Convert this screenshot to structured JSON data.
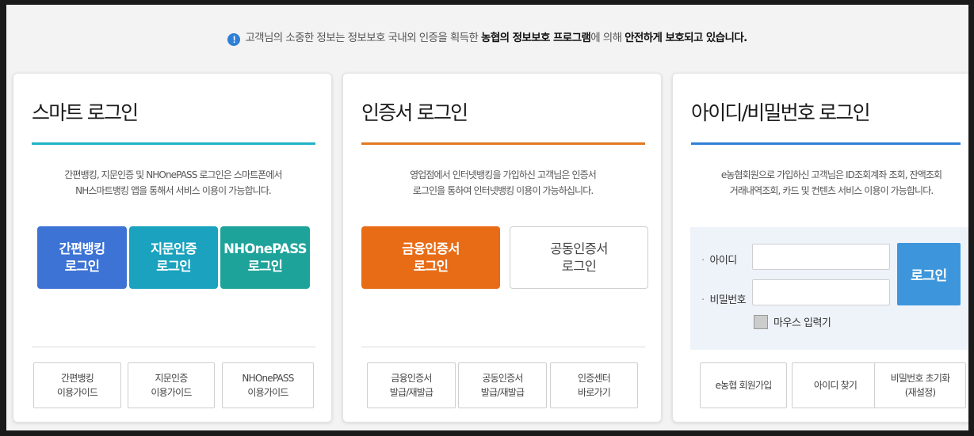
{
  "notice": {
    "icon": "exclamation-icon",
    "text_plain": "고객님의 소중한 정보는 정보보호 국내외 인증을 획득한 ",
    "text_bold_1": "농협의 정보보호 프로그램",
    "text_plain_2": "에 의해 ",
    "text_bold_2": "안전하게 보호되고 있습니다."
  },
  "smart": {
    "title": "스마트 로그인",
    "accent": "#1fb2c7",
    "desc_1": "간편뱅킹, 지문인증 및 NHOnePASS 로그인은 스마트폰에서",
    "desc_2": "NH스마트뱅킹 앱을 통해서 서비스 이용이 가능합니다.",
    "buttons": [
      {
        "line1": "간편뱅킹",
        "line2": "로그인",
        "color": "#3d73d4"
      },
      {
        "line1": "지문인증",
        "line2": "로그인",
        "color": "#1aa2bf"
      },
      {
        "line1": "NHOnePASS",
        "line2": "로그인",
        "color": "#1ea39b"
      }
    ],
    "guides": [
      {
        "line1": "간편뱅킹",
        "line2": "이용가이드"
      },
      {
        "line1": "지문인증",
        "line2": "이용가이드"
      },
      {
        "line1": "NHOnePASS",
        "line2": "이용가이드"
      }
    ]
  },
  "cert": {
    "title": "인증서 로그인",
    "accent": "#e2781f",
    "desc_1": "영업점에서 인터넷뱅킹을 가입하신 고객님은 인증서",
    "desc_2": "로그인을 통하여 인터넷뱅킹 이용이 가능하십니다.",
    "buttons": [
      {
        "line1": "금융인증서",
        "line2": "로그인",
        "color": "#e86c16"
      },
      {
        "line1": "공동인증서",
        "line2": "로그인",
        "color": "#ffffff"
      }
    ],
    "guides": [
      {
        "line1": "금융인증서",
        "line2": "발급/재발급"
      },
      {
        "line1": "공동인증서",
        "line2": "발급/재발급"
      },
      {
        "line1": "인증센터",
        "line2": "바로가기"
      }
    ]
  },
  "idpw": {
    "title": "아이디/비밀번호 로그인",
    "accent": "#2f7fd6",
    "desc_1": "e농협회원으로 가입하신 고객님은 ID조회계좌 조회, 잔액조회",
    "desc_2": "거래내역조회, 카드 및 컨텐츠 서비스 이용이 가능합니다.",
    "id_label": "아이디",
    "id_value": "",
    "pw_label": "비밀번호",
    "pw_value": "",
    "login_label": "로그인",
    "mouse_label": "마우스 입력기",
    "guides": [
      {
        "line1": "e농협 회원가입",
        "line2": ""
      },
      {
        "line1": "아이디 찾기",
        "line2": ""
      },
      {
        "line1": "비밀번호 초기화",
        "line2": "(재설정)"
      }
    ]
  }
}
